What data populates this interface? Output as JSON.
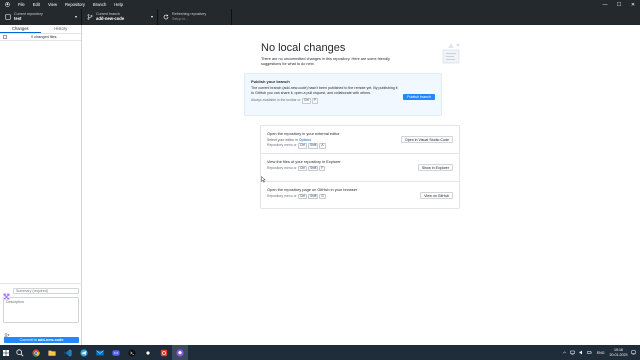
{
  "menubar": {
    "items": [
      "File",
      "Edit",
      "View",
      "Repository",
      "Branch",
      "Help"
    ]
  },
  "window_controls": {
    "minimize": "—",
    "maximize": "☐",
    "close": "✕"
  },
  "toolbar": {
    "repo_label": "Current repository",
    "repo_value": "test",
    "branch_label": "Current branch",
    "branch_value": "add-new-code",
    "refresh_label": "Refreshing repository",
    "refresh_sub": "Setup in..."
  },
  "sidebar": {
    "tabs": [
      "Changes",
      "History"
    ],
    "changed_files": "0 changed files",
    "summary_placeholder": "Summary (required)",
    "description_placeholder": "Description",
    "commit_prefix": "Commit to ",
    "commit_branch": "add-new-code"
  },
  "main": {
    "title": "No local changes",
    "description": "There are no uncommitted changes in this repository. Here are some friendly suggestions for what to do next.",
    "publish": {
      "title": "Publish your branch",
      "description": "The current branch (add-new-code) hasn't been published to the remote yet. By publishing it to GitHub you can share it, open a pull request, and collaborate with others.",
      "hint": "Always available in the toolbar or",
      "keys": [
        "Ctrl",
        "P"
      ],
      "button": "Publish branch"
    },
    "actions": [
      {
        "title": "Open the repository in your external editor",
        "sub_prefix": "Select your editor in",
        "sub_link": "Options",
        "hint": "Repository menu or",
        "keys": [
          "Ctrl",
          "Shift",
          "A"
        ],
        "button": "Open in Visual Studio Code"
      },
      {
        "title": "View the files of your repository in Explorer",
        "hint": "Repository menu or",
        "keys": [
          "Ctrl",
          "Shift",
          "F"
        ],
        "button": "Show in Explorer"
      },
      {
        "title": "Open the repository page on GitHub in your browser",
        "hint": "Repository menu or",
        "keys": [
          "Ctrl",
          "Shift",
          "G"
        ],
        "button": "View on GitHub"
      }
    ]
  },
  "taskbar": {
    "lang": "ENG",
    "time": "19:16",
    "date": "20.01.2023"
  },
  "colors": {
    "dark": "#24292e",
    "accent": "#2188ff",
    "taskbar": "#1f2c3a"
  }
}
